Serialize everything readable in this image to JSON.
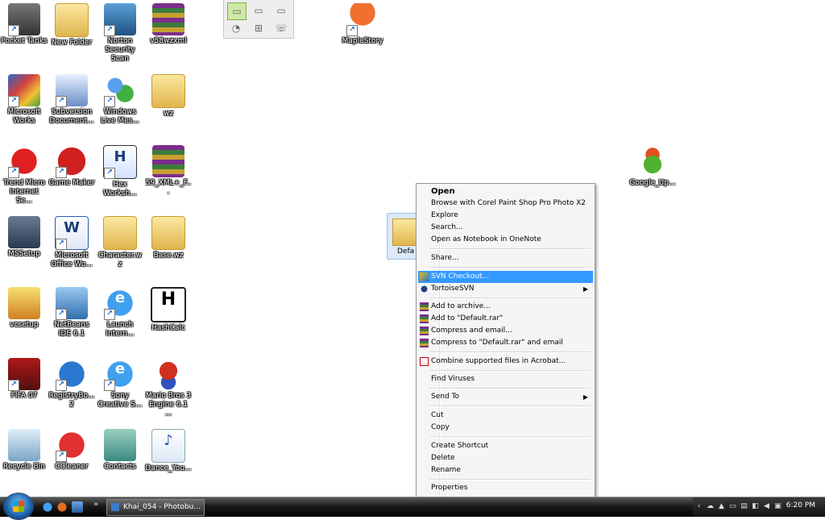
{
  "desktop": {
    "icons": [
      {
        "label": "Pocket Tanks",
        "name": "pocket-tanks"
      },
      {
        "label": "New Folder",
        "name": "new-folder"
      },
      {
        "label": "Norton Security Scan",
        "name": "norton-security-scan"
      },
      {
        "label": "v58wzxml",
        "name": "v58wzxml"
      },
      {
        "label": "MapleStory",
        "name": "maplestory"
      },
      {
        "label": "Microsoft Works",
        "name": "microsoft-works"
      },
      {
        "label": "Subversion Document...",
        "name": "subversion-document"
      },
      {
        "label": "Windows Live Mes...",
        "name": "windows-live-messenger"
      },
      {
        "label": "wz",
        "name": "wz"
      },
      {
        "label": "Trend Micro Internet Se...",
        "name": "trend-micro"
      },
      {
        "label": "Game Maker",
        "name": "game-maker"
      },
      {
        "label": "Hex Worksh...",
        "name": "hex-workshop"
      },
      {
        "label": "59_XML+_F...",
        "name": "xml-archive"
      },
      {
        "label": "Google_Up...",
        "name": "google-updater"
      },
      {
        "label": "MSSetup",
        "name": "mssetup"
      },
      {
        "label": "Microsoft Office Wo...",
        "name": "microsoft-office-word"
      },
      {
        "label": "Character.wz",
        "name": "character-wz"
      },
      {
        "label": "Base.wz",
        "name": "base-wz"
      },
      {
        "label": "vcsetup",
        "name": "vcsetup"
      },
      {
        "label": "NetBeans IDE 6.1",
        "name": "netbeans-ide"
      },
      {
        "label": "Launch Intern...",
        "name": "launch-internet-explorer"
      },
      {
        "label": "HashCalc",
        "name": "hashcalc"
      },
      {
        "label": "FIFA 07",
        "name": "fifa-07"
      },
      {
        "label": "RegistryBo... 2",
        "name": "registry-booster"
      },
      {
        "label": "Sony Creative S...",
        "name": "sony-creative"
      },
      {
        "label": "Mario Bros 3 Engine 6.1 ...",
        "name": "mario-bros-engine"
      },
      {
        "label": "Recycle Bin",
        "name": "recycle-bin"
      },
      {
        "label": "CCleaner",
        "name": "ccleaner"
      },
      {
        "label": "Contacts",
        "name": "contacts"
      },
      {
        "label": "Dance_You...",
        "name": "dance-wma"
      }
    ],
    "selected_folder_label": "Defa"
  },
  "context_menu": {
    "open": "Open",
    "browse_corel": "Browse with Corel Paint Shop Pro Photo X2",
    "explore": "Explore",
    "search": "Search...",
    "open_onenote": "Open as Notebook in OneNote",
    "share": "Share...",
    "svn_checkout": "SVN Checkout...",
    "tortoise_svn": "TortoiseSVN",
    "add_archive": "Add to archive...",
    "add_default_rar": "Add to \"Default.rar\"",
    "compress_email": "Compress and email...",
    "compress_default_email": "Compress to \"Default.rar\" and email",
    "combine_acrobat": "Combine supported files in Acrobat...",
    "find_viruses": "Find Viruses",
    "send_to": "Send To",
    "cut": "Cut",
    "copy": "Copy",
    "create_shortcut": "Create Shortcut",
    "delete": "Delete",
    "rename": "Rename",
    "properties": "Properties",
    "highlight_color": "#3399ff"
  },
  "taskbar": {
    "task_label": "Khai_054 - Photobu...",
    "clock": "6:20 PM",
    "quicklaunch_more": "»"
  }
}
